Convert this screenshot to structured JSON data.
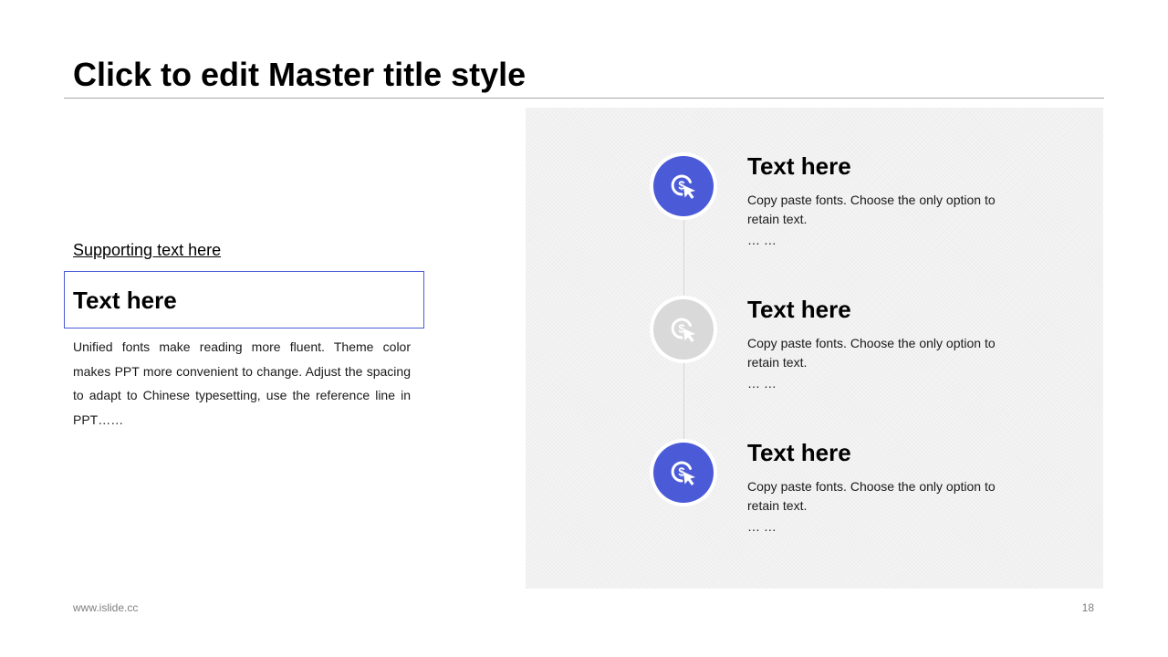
{
  "slide": {
    "title": "Click to edit Master title style",
    "supporting_text": "Supporting text here",
    "heading": "Text here",
    "paragraph": "Unified fonts make reading more fluent. Theme color makes PPT more convenient to change. Adjust the spacing to adapt to Chinese typesetting, use the reference line in PPT……"
  },
  "timeline": {
    "items": [
      {
        "title": "Text here",
        "desc": "Copy paste fonts. Choose the only option to retain text.",
        "ellipsis": "… …",
        "icon": "dollar-click-icon",
        "state": "active"
      },
      {
        "title": "Text here",
        "desc": "Copy paste fonts. Choose the only option to retain text.",
        "ellipsis": "… …",
        "icon": "dollar-click-icon",
        "state": "inactive"
      },
      {
        "title": "Text here",
        "desc": "Copy paste fonts. Choose the only option to retain text.",
        "ellipsis": "… …",
        "icon": "dollar-click-icon",
        "state": "active"
      }
    ]
  },
  "footer": {
    "url": "www.islide.cc",
    "page_number": "18"
  },
  "colors": {
    "accent": "#4b5bd8",
    "inactive": "#d9d9d9",
    "panel_background": "#f1f1f1",
    "rule": "#a6a6a6"
  }
}
